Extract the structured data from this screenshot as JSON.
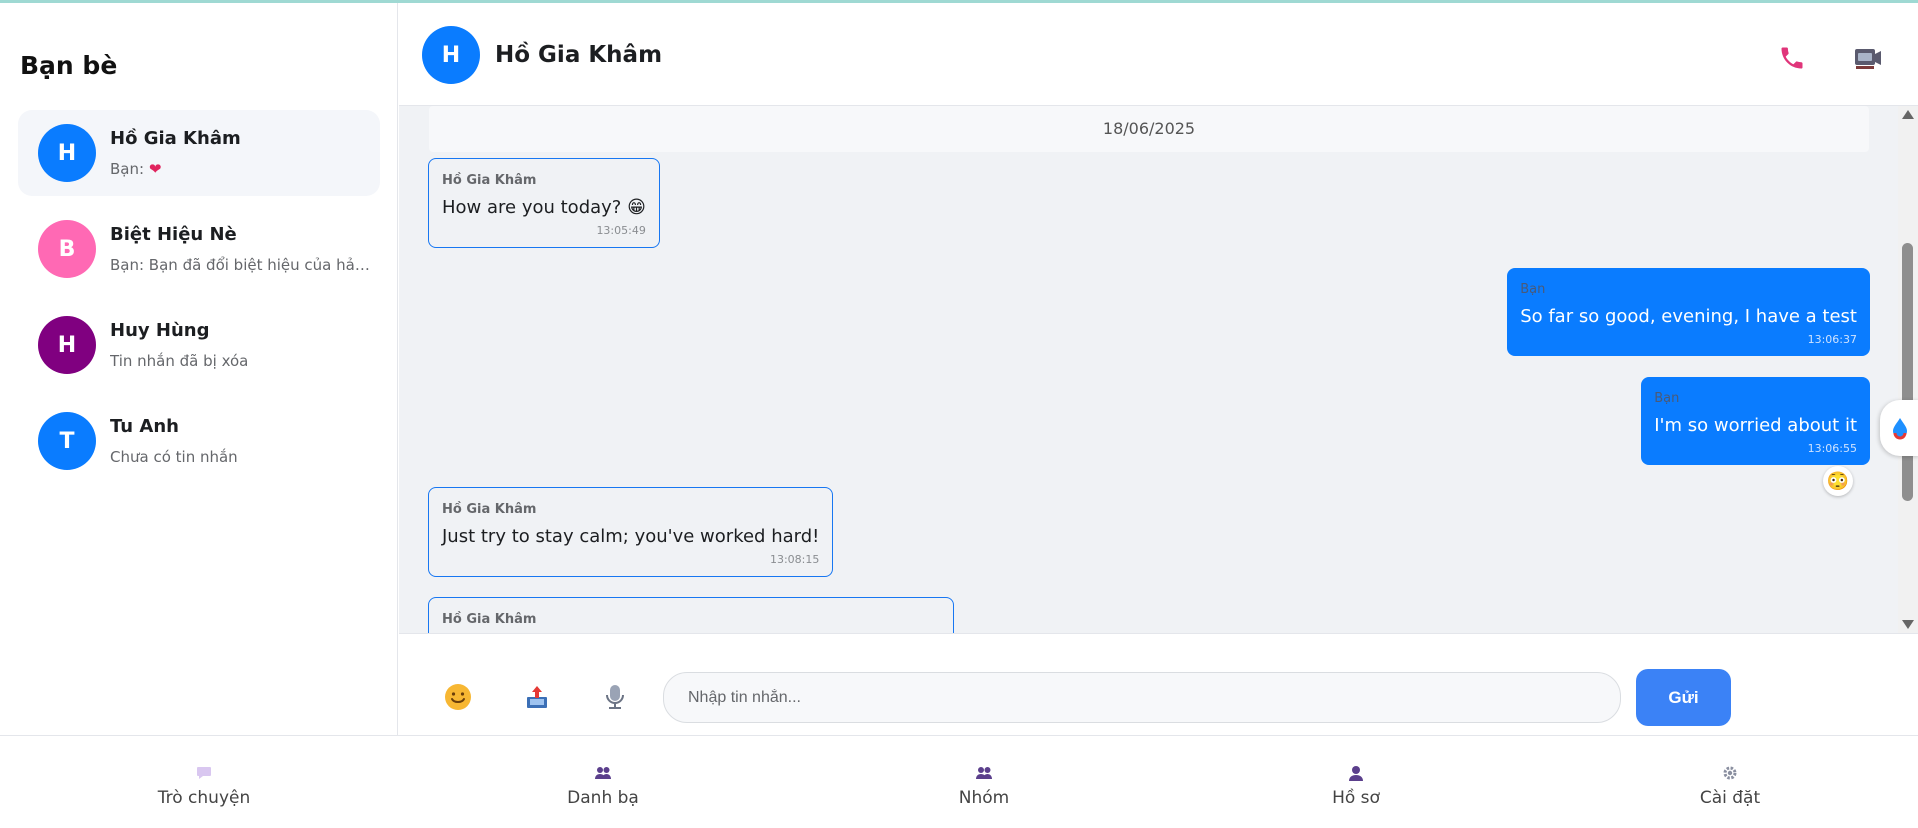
{
  "sidebar": {
    "title": "Bạn bè",
    "friends": [
      {
        "initial": "H",
        "name": "Hồ Gia Khâm",
        "preview": "Bạn: ",
        "preview_emoji": "❤",
        "avatar_color": "#0a7cff",
        "active": true
      },
      {
        "initial": "B",
        "name": "Biệt Hiệu Nè",
        "preview": "Bạn: Bạn đã đổi biệt hiệu của hảo ...",
        "avatar_color": "#ff69b4"
      },
      {
        "initial": "H",
        "name": "Huy Hùng",
        "preview": "Tin nhắn đã bị xóa",
        "avatar_color": "#800080"
      },
      {
        "initial": "T",
        "name": "Tu Anh",
        "preview": "Chưa có tin nhắn",
        "avatar_color": "#0a7cff"
      }
    ]
  },
  "chat": {
    "contact_initial": "H",
    "contact_name": "Hồ Gia Khâm",
    "contact_avatar_color": "#0a7cff",
    "icons": [
      "phone-icon",
      "video-camera-icon"
    ]
  },
  "messages": {
    "date": "18/06/2025",
    "items": [
      {
        "direction": "in",
        "sender": "Hồ Gia Khâm",
        "text": "How are you today? 😁",
        "time": "13:05:49"
      },
      {
        "direction": "out",
        "sender": "Bạn",
        "text": "So far so good, evening, I have a test",
        "time": "13:06:37"
      },
      {
        "direction": "out",
        "sender": "Bạn",
        "text": "I'm so worried about it",
        "time": "13:06:55",
        "reaction": "😳"
      },
      {
        "direction": "in",
        "sender": "Hồ Gia Khâm",
        "text": "Just try to stay calm; you've worked hard!",
        "time": "13:08:15"
      },
      {
        "direction": "in",
        "sender": "Hồ Gia Khâm",
        "text": "",
        "time": ""
      }
    ]
  },
  "composer": {
    "placeholder": "Nhập tin nhắn...",
    "send_label": "Gửi",
    "icons": [
      "emoji-icon",
      "upload-file-icon",
      "microphone-icon"
    ]
  },
  "bottom_nav": {
    "items": [
      {
        "label": "Trò chuyện",
        "icon": "chat-bubble-icon"
      },
      {
        "label": "Danh bạ",
        "icon": "contacts-icon"
      },
      {
        "label": "Nhóm",
        "icon": "group-icon"
      },
      {
        "label": "Hồ sơ",
        "icon": "profile-icon"
      },
      {
        "label": "Cài đặt",
        "icon": "settings-gear-icon"
      }
    ]
  },
  "colors": {
    "accent": "#0a7cff",
    "send_button": "#3b82f6",
    "chat_background": "#f0f2f5",
    "phone_icon": "#e0357a"
  }
}
